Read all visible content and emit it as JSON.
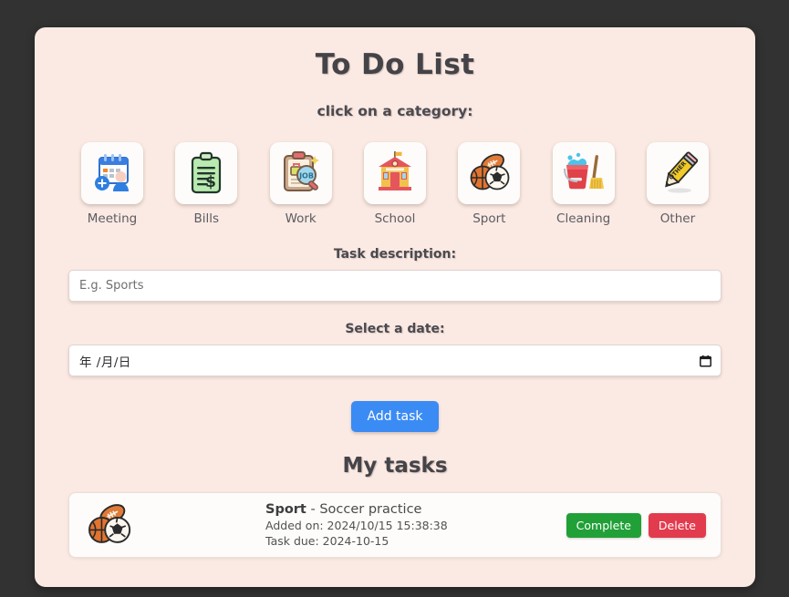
{
  "app": {
    "title": "To Do List",
    "subtitle": "click on a category:",
    "background_color": "#323232",
    "card_color": "#fbeae3"
  },
  "categories": [
    {
      "label": "Meeting",
      "icon": "calendar-person-icon"
    },
    {
      "label": "Bills",
      "icon": "clipboard-dollar-icon"
    },
    {
      "label": "Work",
      "icon": "clipboard-job-magnifier-icon"
    },
    {
      "label": "School",
      "icon": "school-building-icon"
    },
    {
      "label": "Sport",
      "icon": "sport-balls-icon"
    },
    {
      "label": "Cleaning",
      "icon": "bucket-broom-icon"
    },
    {
      "label": "Other",
      "icon": "pencil-icon"
    }
  ],
  "form": {
    "description_label": "Task description:",
    "description_placeholder": "E.g. Sports",
    "description_value": "",
    "date_label": "Select a date:",
    "date_placeholder": "年 /月/日",
    "date_value": "",
    "submit_label": "Add task",
    "submit_color": "#3b8bf4"
  },
  "tasks_section": {
    "heading": "My tasks",
    "complete_label": "Complete",
    "delete_label": "Delete",
    "complete_color": "#21a038",
    "delete_color": "#e23b4e",
    "items": [
      {
        "category": "Sport",
        "separator": " - ",
        "description": "Soccer practice",
        "added_on": "Added on: 2024/10/15 15:38:38",
        "due": "Task due: 2024-10-15",
        "icon": "sport-balls-icon"
      }
    ]
  }
}
